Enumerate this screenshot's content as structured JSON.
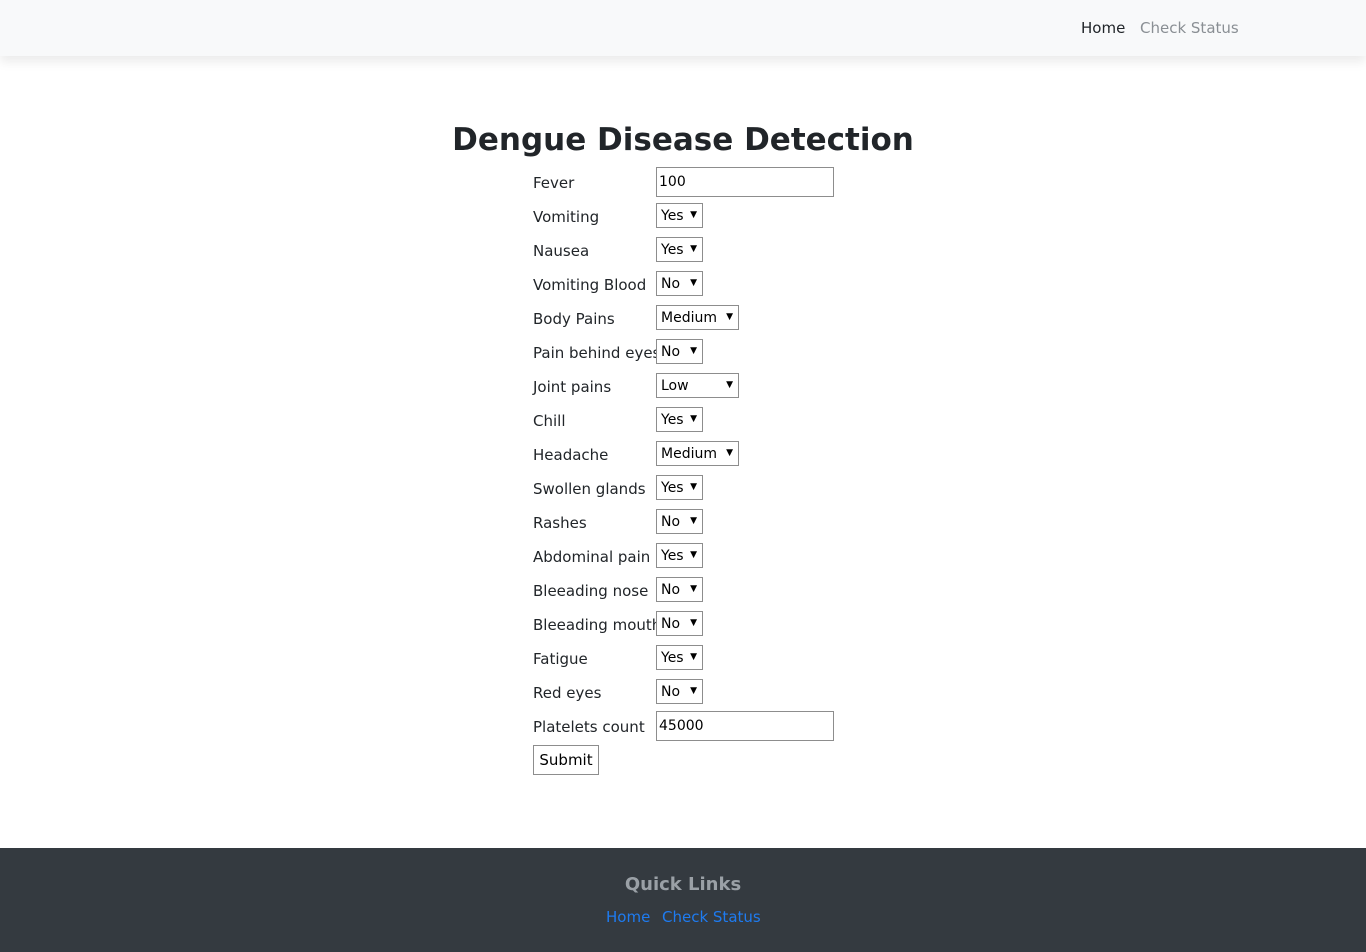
{
  "nav": {
    "home": "Home",
    "check_status": "Check Status"
  },
  "title": "Dengue Disease Detection",
  "form": {
    "fever": {
      "label": "Fever",
      "value": "100"
    },
    "vomiting": {
      "label": "Vomiting",
      "value": "Yes"
    },
    "nausea": {
      "label": "Nausea",
      "value": "Yes"
    },
    "vomiting_blood": {
      "label": "Vomiting Blood",
      "value": "No"
    },
    "body_pains": {
      "label": "Body Pains",
      "value": "Medium"
    },
    "pain_behind_eyes": {
      "label": "Pain behind eyes",
      "value": "No"
    },
    "joint_pains": {
      "label": "Joint pains",
      "value": "Low"
    },
    "chill": {
      "label": "Chill",
      "value": "Yes"
    },
    "headache": {
      "label": "Headache",
      "value": "Medium"
    },
    "swollen_glands": {
      "label": "Swollen glands",
      "value": "Yes"
    },
    "rashes": {
      "label": "Rashes",
      "value": "No"
    },
    "abdominal_pain": {
      "label": "Abdominal pain",
      "value": "Yes"
    },
    "bleeding_nose": {
      "label": "Bleeading nose",
      "value": "No"
    },
    "bleeding_mouth": {
      "label": "Bleeading mouth",
      "value": "No"
    },
    "fatigue": {
      "label": "Fatigue",
      "value": "Yes"
    },
    "red_eyes": {
      "label": "Red eyes",
      "value": "No"
    },
    "platelets_count": {
      "label": "Platelets count",
      "value": "45000"
    },
    "submit_label": "Submit"
  },
  "footer": {
    "title": "Quick Links",
    "home": "Home",
    "check_status": "Check Status",
    "link_color": "#1e7bf0",
    "background": "#343a40"
  },
  "icons": {
    "dropdown": "dropdown-arrow-icon"
  }
}
